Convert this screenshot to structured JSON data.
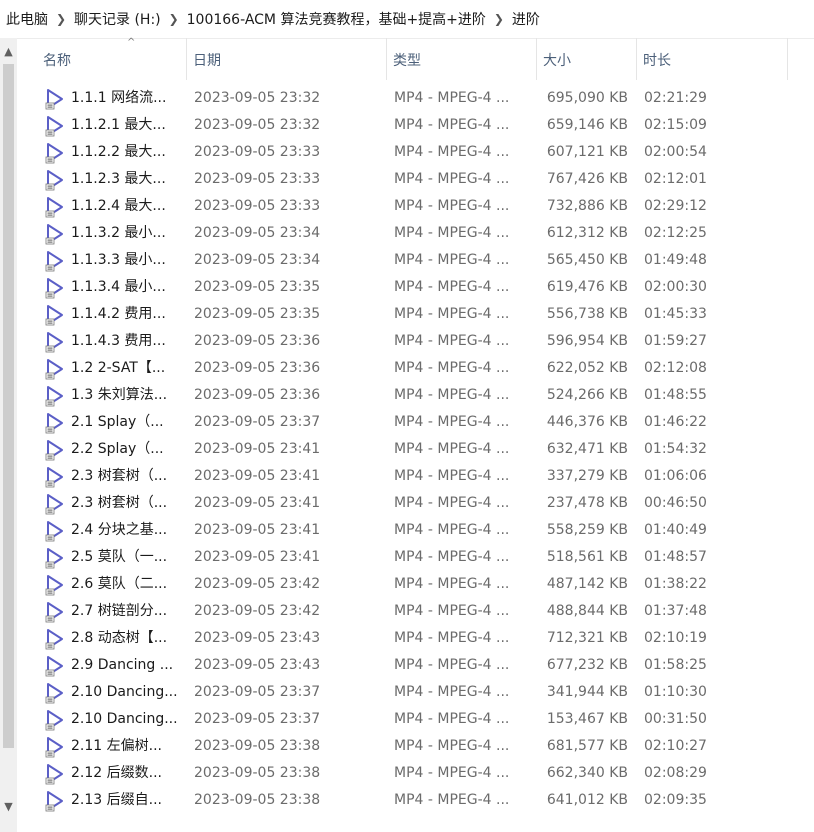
{
  "breadcrumb": [
    "此电脑",
    "聊天记录 (H:)",
    "100166-ACM 算法竞赛教程，基础+提高+进阶",
    "进阶"
  ],
  "scroll": {
    "up": "▲",
    "down": "▼"
  },
  "columns": {
    "name": "名称",
    "date": "日期",
    "type": "类型",
    "size": "大小",
    "duration": "时长",
    "sort_indicator": "^"
  },
  "colors": {
    "icon": "#5b5fc7",
    "header_text": "#4c607a"
  },
  "files": [
    {
      "name": "1.1.1 网络流...",
      "date": "2023-09-05 23:32",
      "type": "MP4 - MPEG-4 ...",
      "size": "695,090 KB",
      "duration": "02:21:29"
    },
    {
      "name": "1.1.2.1 最大...",
      "date": "2023-09-05 23:32",
      "type": "MP4 - MPEG-4 ...",
      "size": "659,146 KB",
      "duration": "02:15:09"
    },
    {
      "name": "1.1.2.2 最大...",
      "date": "2023-09-05 23:33",
      "type": "MP4 - MPEG-4 ...",
      "size": "607,121 KB",
      "duration": "02:00:54"
    },
    {
      "name": "1.1.2.3 最大...",
      "date": "2023-09-05 23:33",
      "type": "MP4 - MPEG-4 ...",
      "size": "767,426 KB",
      "duration": "02:12:01"
    },
    {
      "name": "1.1.2.4 最大...",
      "date": "2023-09-05 23:33",
      "type": "MP4 - MPEG-4 ...",
      "size": "732,886 KB",
      "duration": "02:29:12"
    },
    {
      "name": "1.1.3.2 最小...",
      "date": "2023-09-05 23:34",
      "type": "MP4 - MPEG-4 ...",
      "size": "612,312 KB",
      "duration": "02:12:25"
    },
    {
      "name": "1.1.3.3 最小...",
      "date": "2023-09-05 23:34",
      "type": "MP4 - MPEG-4 ...",
      "size": "565,450 KB",
      "duration": "01:49:48"
    },
    {
      "name": "1.1.3.4 最小...",
      "date": "2023-09-05 23:35",
      "type": "MP4 - MPEG-4 ...",
      "size": "619,476 KB",
      "duration": "02:00:30"
    },
    {
      "name": "1.1.4.2 费用...",
      "date": "2023-09-05 23:35",
      "type": "MP4 - MPEG-4 ...",
      "size": "556,738 KB",
      "duration": "01:45:33"
    },
    {
      "name": "1.1.4.3 费用...",
      "date": "2023-09-05 23:36",
      "type": "MP4 - MPEG-4 ...",
      "size": "596,954 KB",
      "duration": "01:59:27"
    },
    {
      "name": "1.2 2-SAT【...",
      "date": "2023-09-05 23:36",
      "type": "MP4 - MPEG-4 ...",
      "size": "622,052 KB",
      "duration": "02:12:08"
    },
    {
      "name": "1.3 朱刘算法...",
      "date": "2023-09-05 23:36",
      "type": "MP4 - MPEG-4 ...",
      "size": "524,266 KB",
      "duration": "01:48:55"
    },
    {
      "name": "2.1 Splay（...",
      "date": "2023-09-05 23:37",
      "type": "MP4 - MPEG-4 ...",
      "size": "446,376 KB",
      "duration": "01:46:22"
    },
    {
      "name": "2.2 Splay（...",
      "date": "2023-09-05 23:41",
      "type": "MP4 - MPEG-4 ...",
      "size": "632,471 KB",
      "duration": "01:54:32"
    },
    {
      "name": "2.3 树套树（...",
      "date": "2023-09-05 23:41",
      "type": "MP4 - MPEG-4 ...",
      "size": "337,279 KB",
      "duration": "01:06:06"
    },
    {
      "name": "2.3 树套树（...",
      "date": "2023-09-05 23:41",
      "type": "MP4 - MPEG-4 ...",
      "size": "237,478 KB",
      "duration": "00:46:50"
    },
    {
      "name": "2.4 分块之基...",
      "date": "2023-09-05 23:41",
      "type": "MP4 - MPEG-4 ...",
      "size": "558,259 KB",
      "duration": "01:40:49"
    },
    {
      "name": "2.5 莫队（一...",
      "date": "2023-09-05 23:41",
      "type": "MP4 - MPEG-4 ...",
      "size": "518,561 KB",
      "duration": "01:48:57"
    },
    {
      "name": "2.6 莫队（二...",
      "date": "2023-09-05 23:42",
      "type": "MP4 - MPEG-4 ...",
      "size": "487,142 KB",
      "duration": "01:38:22"
    },
    {
      "name": "2.7 树链剖分...",
      "date": "2023-09-05 23:42",
      "type": "MP4 - MPEG-4 ...",
      "size": "488,844 KB",
      "duration": "01:37:48"
    },
    {
      "name": "2.8 动态树【...",
      "date": "2023-09-05 23:43",
      "type": "MP4 - MPEG-4 ...",
      "size": "712,321 KB",
      "duration": "02:10:19"
    },
    {
      "name": "2.9 Dancing ...",
      "date": "2023-09-05 23:43",
      "type": "MP4 - MPEG-4 ...",
      "size": "677,232 KB",
      "duration": "01:58:25"
    },
    {
      "name": "2.10 Dancing...",
      "date": "2023-09-05 23:37",
      "type": "MP4 - MPEG-4 ...",
      "size": "341,944 KB",
      "duration": "01:10:30"
    },
    {
      "name": "2.10 Dancing...",
      "date": "2023-09-05 23:37",
      "type": "MP4 - MPEG-4 ...",
      "size": "153,467 KB",
      "duration": "00:31:50"
    },
    {
      "name": "2.11 左偏树...",
      "date": "2023-09-05 23:38",
      "type": "MP4 - MPEG-4 ...",
      "size": "681,577 KB",
      "duration": "02:10:27"
    },
    {
      "name": "2.12 后缀数...",
      "date": "2023-09-05 23:38",
      "type": "MP4 - MPEG-4 ...",
      "size": "662,340 KB",
      "duration": "02:08:29"
    },
    {
      "name": "2.13 后缀自...",
      "date": "2023-09-05 23:38",
      "type": "MP4 - MPEG-4 ...",
      "size": "641,012 KB",
      "duration": "02:09:35"
    }
  ]
}
